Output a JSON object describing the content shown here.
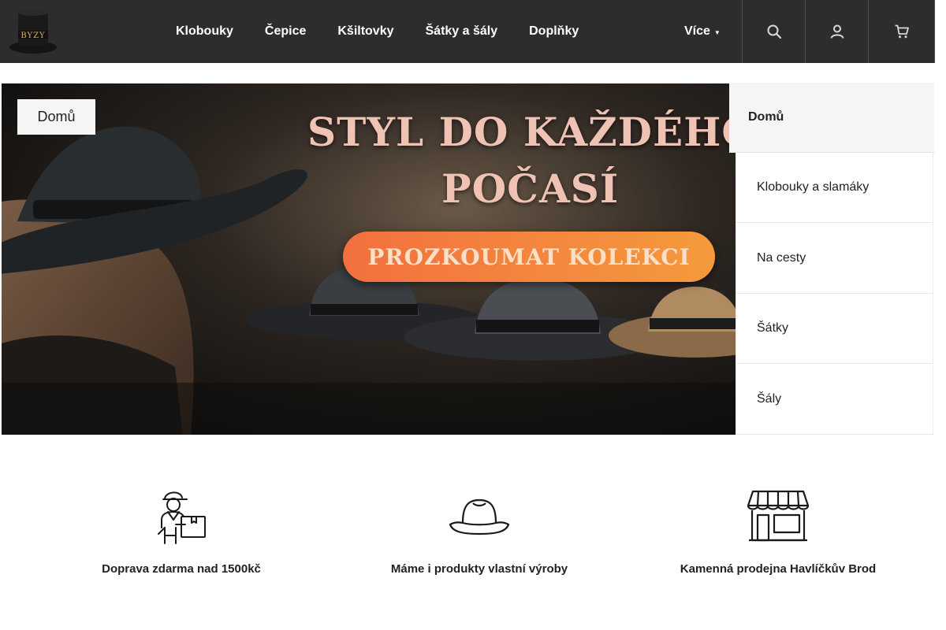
{
  "header": {
    "logo_text": "BYZY",
    "nav": [
      {
        "label": "Klobouky"
      },
      {
        "label": "Čepice"
      },
      {
        "label": "Kšiltovky"
      },
      {
        "label": "Šátky a šály"
      },
      {
        "label": "Doplňky"
      }
    ],
    "more_label": "Více",
    "icons": [
      "search-icon",
      "user-icon",
      "cart-icon"
    ]
  },
  "hero": {
    "title_line1": "STYL DO KAŽDÉHO",
    "title_line2": "POČASÍ",
    "cta_label": "PROZKOUMAT KOLEKCI",
    "badge_label": "Domů"
  },
  "side_menu": {
    "items": [
      {
        "label": "Domů",
        "active": true
      },
      {
        "label": "Klobouky a slamáky"
      },
      {
        "label": "Na cesty"
      },
      {
        "label": "Šátky"
      },
      {
        "label": "Šály"
      }
    ]
  },
  "features": [
    {
      "label": "Doprava zdarma nad 1500kč",
      "icon": "delivery-person-icon"
    },
    {
      "label": "Máme i produkty vlastní výroby",
      "icon": "hat-icon"
    },
    {
      "label": "Kamenná prodejna Havlíčkův Brod",
      "icon": "store-icon"
    }
  ],
  "colors": {
    "header_bg": "#2d2d2d",
    "cta_gradient_start": "#f2703e",
    "cta_gradient_end": "#f59a3c",
    "hero_title": "#efc2b3"
  }
}
